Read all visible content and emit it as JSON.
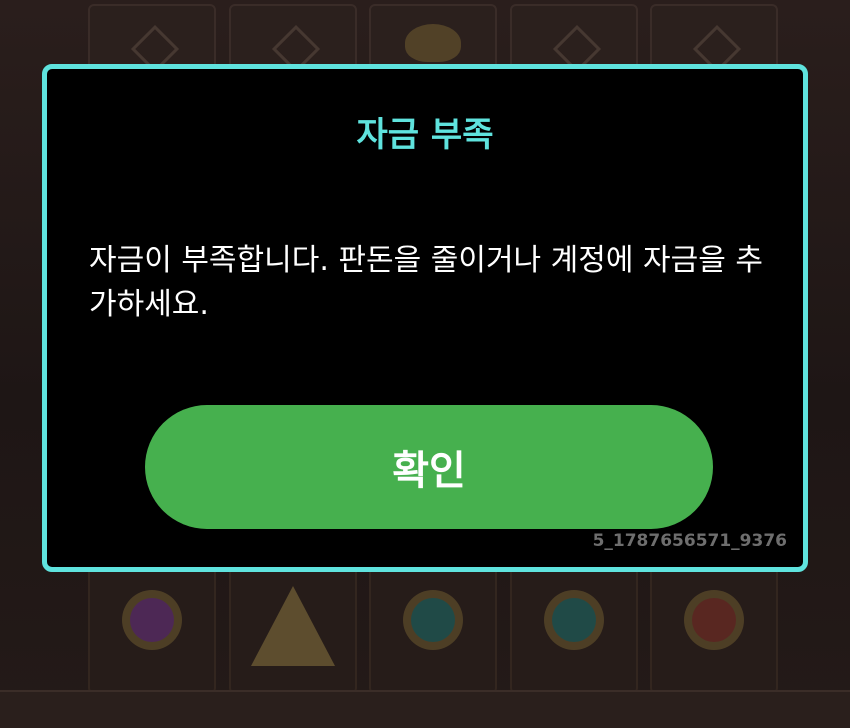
{
  "dialog": {
    "title": "자금 부족",
    "message": "자금이 부족합니다. 판돈을 줄이거나 계정에 자금을 추가하세요.",
    "confirm_label": "확인",
    "session_id": "5_1787656571_9376"
  },
  "colors": {
    "accent": "#5fe3de",
    "confirm_button": "#46b04e",
    "dialog_background": "#000000"
  },
  "background": {
    "top_row_icons": [
      "glyph-icon",
      "glyph-icon",
      "scarab-icon",
      "glyph-icon",
      "glyph-icon"
    ],
    "bottom_row_icons": [
      "purple-gem-icon",
      "pyramid-icon",
      "teal-gem-icon",
      "teal-gem-icon",
      "red-ankh-gem-icon"
    ]
  }
}
